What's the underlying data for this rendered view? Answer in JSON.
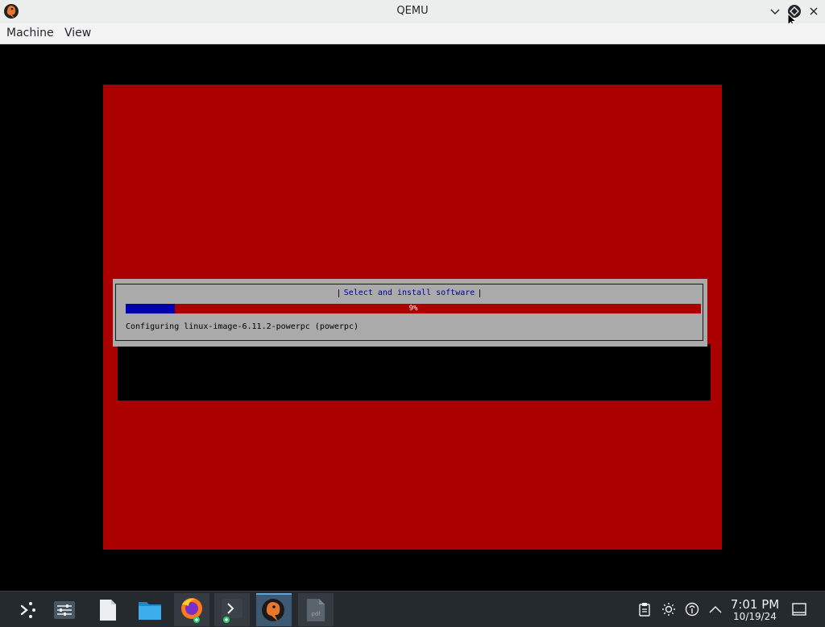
{
  "window": {
    "title": "QEMU",
    "menu": [
      "Machine",
      "View"
    ]
  },
  "installer": {
    "dialog_title": "Select and install software",
    "progress_percent": 9,
    "progress_label": "9%",
    "status": "Configuring linux-image-6.11.2-powerpc (powerpc)"
  },
  "taskbar": {
    "apps": [
      {
        "name": "application-launcher-icon"
      },
      {
        "name": "settings-icon"
      },
      {
        "name": "document-icon"
      },
      {
        "name": "folder-icon"
      },
      {
        "name": "firefox-icon"
      },
      {
        "name": "terminal-icon"
      },
      {
        "name": "qemu-icon"
      },
      {
        "name": "pdf-icon"
      }
    ],
    "clock": {
      "time": "7:01 PM",
      "date": "10/19/24"
    }
  },
  "colors": {
    "installer_background": "#aa0000",
    "dialog_background": "#aaaaaa",
    "progress_fill": "#0000aa",
    "dialog_title": "#0000aa",
    "taskbar": "#252a2f",
    "titlebar": "#eceded"
  }
}
